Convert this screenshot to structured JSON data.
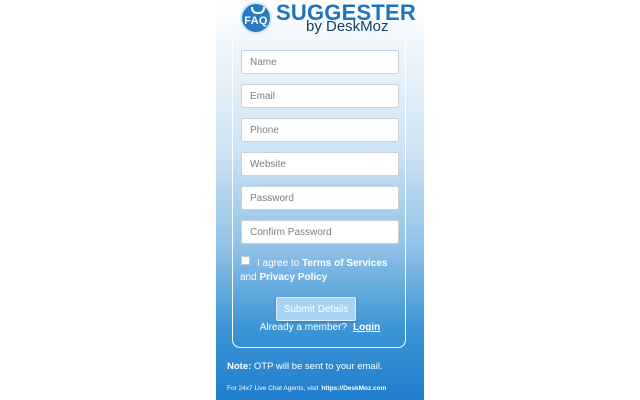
{
  "logo": {
    "badge_text": "FAQ",
    "title": "SUGGESTER",
    "subtitle": "by DeskMoz",
    "badge_icon": "graduation-cap-icon"
  },
  "form": {
    "name_placeholder": "Name",
    "email_placeholder": "Email",
    "phone_placeholder": "Phone",
    "website_placeholder": "Website",
    "password_placeholder": "Password",
    "confirm_password_placeholder": "Confirm Password",
    "agree_prefix": "I agree to",
    "terms_link": "Terms of Services",
    "agree_and": "and",
    "privacy_link": "Privacy Policy",
    "terms_checked": false,
    "submit_label": "Submit Details",
    "member_text": "Already a member?",
    "login_link": "Login"
  },
  "note": {
    "label": "Note:",
    "text": "OTP will be sent to your email."
  },
  "footer": {
    "text": "For 24x7 Live Chat Agents, visit",
    "link": "https://DeskMoz.com"
  },
  "colors": {
    "brand_blue": "#1f74bf",
    "gradient_bottom": "#1f7ecd",
    "button_fill": "#a8d3f2"
  }
}
